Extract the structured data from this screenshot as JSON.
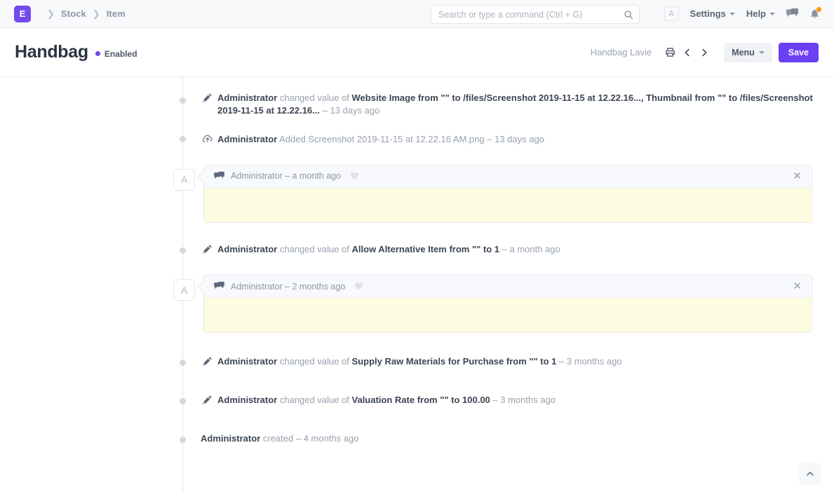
{
  "navbar": {
    "logo_letter": "E",
    "breadcrumb": [
      "Stock",
      "Item"
    ],
    "search_placeholder": "Search or type a command (Ctrl + G)",
    "search_value": "",
    "avatar_letter": "A",
    "settings_label": "Settings",
    "help_label": "Help",
    "icons": [
      "search-icon",
      "chat-icon",
      "bell-icon"
    ],
    "accent_color": "#7349ec",
    "badge_color": "#ff9800"
  },
  "page_head": {
    "title": "Handbag",
    "status": "Enabled",
    "status_color": "#7349ec",
    "subtitle": "Handbag Lavie",
    "menu_label": "Menu",
    "save_label": "Save"
  },
  "timeline": {
    "entries": [
      {
        "type": "activity",
        "icon": "pencil-icon",
        "who": "Administrator",
        "action": "changed value of",
        "detail": "Website Image from \"\" to /files/Screenshot 2019-11-15 at 12.22.16..., Thumbnail from \"\" to /files/Screenshot 2019-11-15 at 12.22.16...",
        "when": "– 13 days ago"
      },
      {
        "type": "activity",
        "icon": "cloud-upload-icon",
        "who": "Administrator",
        "action": "Added Screenshot 2019-11-15 at 12.22.16 AM.png",
        "detail": "",
        "when": "– 13 days ago"
      },
      {
        "type": "comment",
        "avatar_letter": "A",
        "icon": "comment-icon",
        "meta": "Administrator – a month ago",
        "like_icon": "heart-icon",
        "close_icon": "close-icon",
        "body": ""
      },
      {
        "type": "activity",
        "icon": "pencil-icon",
        "who": "Administrator",
        "action": "changed value of",
        "detail": "Allow Alternative Item from \"\" to 1",
        "when": "– a month ago"
      },
      {
        "type": "comment",
        "avatar_letter": "A",
        "icon": "comment-icon",
        "meta": "Administrator – 2 months ago",
        "like_icon": "heart-icon",
        "close_icon": "close-icon",
        "body": ""
      },
      {
        "type": "activity",
        "icon": "pencil-icon",
        "who": "Administrator",
        "action": "changed value of",
        "detail": "Supply Raw Materials for Purchase from \"\" to 1",
        "when": "– 3 months ago"
      },
      {
        "type": "activity",
        "icon": "pencil-icon",
        "who": "Administrator",
        "action": "changed value of",
        "detail": "Valuation Rate from \"\" to 100.00",
        "when": "– 3 months ago"
      },
      {
        "type": "created",
        "who": "Administrator",
        "action": "created",
        "when": "– 4 months ago"
      }
    ]
  },
  "footer": {
    "scroll_top_icon": "chevron-up-icon"
  }
}
